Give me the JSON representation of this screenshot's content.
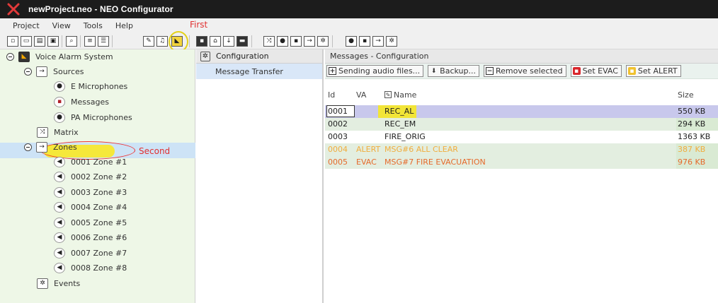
{
  "window": {
    "title": "newProject.neo - NEO Configurator"
  },
  "menu": {
    "items": [
      "Project",
      "View",
      "Tools",
      "Help"
    ]
  },
  "annotations": {
    "first": "First",
    "second": "Second"
  },
  "tree": {
    "root": "Voice Alarm System",
    "sources": "Sources",
    "e_microphones": "E Microphones",
    "messages": "Messages",
    "pa_microphones": "PA Microphones",
    "matrix": "Matrix",
    "zones": "Zones",
    "zone_items": [
      "0001 Zone #1",
      "0002 Zone #2",
      "0003 Zone #3",
      "0004 Zone #4",
      "0005 Zone #5",
      "0006 Zone #6",
      "0007 Zone #7",
      "0008 Zone #8"
    ],
    "events": "Events"
  },
  "middle": {
    "header": "Configuration",
    "item": "Message Transfer"
  },
  "right": {
    "header": "Messages - Configuration",
    "buttons": {
      "send": "Sending audio files...",
      "backup": "Backup...",
      "remove": "Remove selected",
      "set_evac": "Set EVAC",
      "set_alert": "Set ALERT"
    },
    "columns": {
      "id": "Id",
      "va": "VA",
      "name": "Name",
      "size": "Size"
    },
    "rows": [
      {
        "id": "0001",
        "va": "",
        "name": "REC_AL",
        "size": "550 KB"
      },
      {
        "id": "0002",
        "va": "",
        "name": "REC_EM",
        "size": "294 KB"
      },
      {
        "id": "0003",
        "va": "",
        "name": "FIRE_ORIG",
        "size": "1363 KB"
      },
      {
        "id": "0004",
        "va": "ALERT",
        "name": "MSG#6 ALL CLEAR",
        "size": "387 KB"
      },
      {
        "id": "0005",
        "va": "EVAC",
        "name": "MSG#7 FIRE EVACUATION",
        "size": "976 KB"
      }
    ]
  },
  "colors": {
    "alert_row": "#f1ad3d",
    "evac_row": "#e56a2b",
    "tree_bg": "#eef7e7",
    "selection": "#cde3f6"
  }
}
